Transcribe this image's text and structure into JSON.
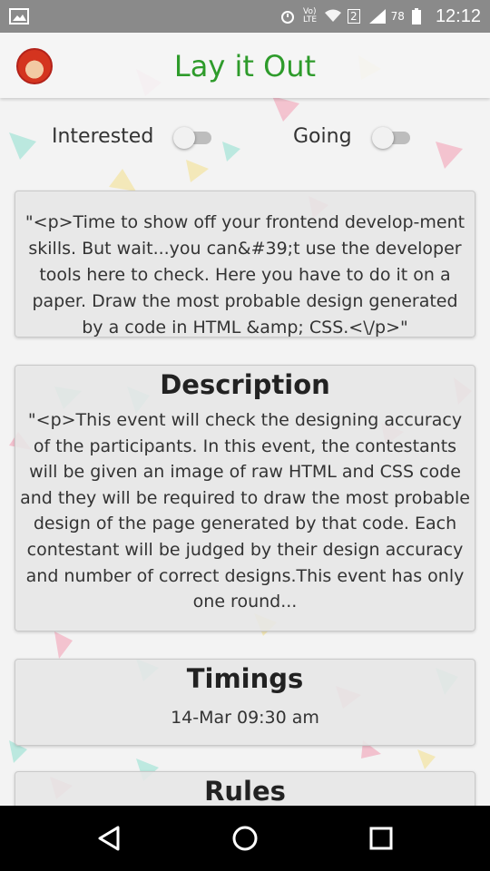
{
  "status_bar": {
    "time": "12:12",
    "battery_level": "78",
    "icons": [
      "gallery-icon",
      "alarm-icon",
      "volte-icon",
      "wifi-icon",
      "sim2-icon",
      "signal-icon",
      "battery-icon"
    ]
  },
  "header": {
    "title": "Lay it Out",
    "logo": "app-logo-icon",
    "title_color": "#2e9b2b"
  },
  "toggles": [
    {
      "label": "Interested",
      "checked": false
    },
    {
      "label": "Going",
      "checked": false
    }
  ],
  "intro": {
    "text": "\"<p>Time to show off your frontend develop-ment skills. But wait...you can&#39;t use the developer tools here to check. Here you have to do it on a paper. Draw the most probable design generated by a code in HTML &amp; CSS.<\\/p>\""
  },
  "description": {
    "heading": "Description",
    "text": "\"<p>This event will check the designing accuracy of the participants. In this event, the contestants will be given an image of raw HTML and CSS code and they will be required to draw the most probable design of the page generated by that code. Each contestant will be judged by their design accuracy and number of correct designs.This event has only one round..."
  },
  "timings": {
    "heading": "Timings",
    "value": "14-Mar 09:30 am"
  },
  "rules": {
    "heading": "Rules"
  },
  "nav": {
    "icons": [
      "back-icon",
      "home-icon",
      "recents-icon"
    ]
  }
}
